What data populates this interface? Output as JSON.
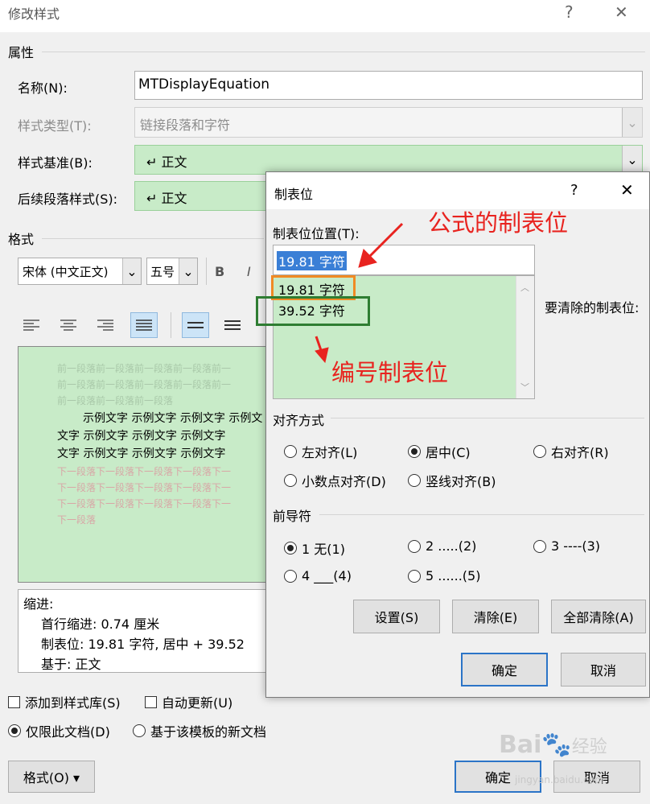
{
  "main_dialog": {
    "title": "修改样式",
    "help": "?",
    "close": "✕",
    "properties_header": "属性",
    "name_label": "名称(N):",
    "name_value": "MTDisplayEquation",
    "style_type_label": "样式类型(T):",
    "style_type_value": "链接段落和字符",
    "based_on_label": "样式基准(B):",
    "based_on_value": "↵ 正文",
    "following_label": "后续段落样式(S):",
    "following_value": "↵ 正文",
    "format_header": "格式",
    "font_value": "宋体 (中文正文)",
    "size_value": "五号",
    "bold": "B",
    "italic": "I",
    "preview": {
      "prev_para_lines": [
        "前一段落前一段落前一段落前一段落前一",
        "前一段落前一段落前一段落前一段落前一",
        "前一段落前一段落前一段落"
      ],
      "sample_lines": [
        "示例文字  示例文字  示例文字  示例文",
        "文字  示例文字  示例文字  示例文字  ",
        "文字  示例文字  示例文字  示例文字  "
      ],
      "next_para_lines": [
        "下一段落下一段落下一段落下一段落下一",
        "下一段落下一段落下一段落下一段落下一",
        "下一段落下一段落下一段落下一段落下一",
        "下一段落"
      ]
    },
    "description": {
      "line1": "缩进:",
      "line2": "首行缩进:  0.74 厘米",
      "line3": "制表位:  19.81 字符, 居中  +   39.52",
      "line4": "基于: 正文"
    },
    "add_to_gallery": "添加到样式库(S)",
    "auto_update": "自动更新(U)",
    "only_this_doc": "仅限此文档(D)",
    "new_docs_template": "基于该模板的新文档",
    "format_button": "格式(O) ▾",
    "ok": "确定",
    "cancel": "取消"
  },
  "tab_dialog": {
    "title": "制表位",
    "help": "?",
    "close": "✕",
    "position_label": "制表位位置(T):",
    "position_value": "19.81 字符",
    "list_items": [
      "19.81 字符",
      "39.52 字符"
    ],
    "clear_label": "要清除的制表位:",
    "alignment_header": "对齐方式",
    "align_left": "左对齐(L)",
    "align_center": "居中(C)",
    "align_right": "右对齐(R)",
    "align_decimal": "小数点对齐(D)",
    "align_bar": "竖线对齐(B)",
    "leader_header": "前导符",
    "leader_1": "1 无(1)",
    "leader_2": "2 .....(2)",
    "leader_3": "3 ----(3)",
    "leader_4": "4 ___(4)",
    "leader_5": "5 ......(5)",
    "set_button": "设置(S)",
    "clear_button": "清除(E)",
    "clear_all_button": "全部清除(A)",
    "ok": "确定",
    "cancel": "取消"
  },
  "annotations": {
    "formula_tab": "公式的制表位",
    "number_tab": "编号制表位"
  },
  "watermark": {
    "brand": "Bai",
    "brand2": "经验",
    "url": "jingyan.baidu.com"
  },
  "colors": {
    "green_fill": "#c8ebc8",
    "orange_box": "#f08a24",
    "green_box": "#2e7d32",
    "annotation_red": "#e8231f",
    "default_button_border": "#2b74c7"
  }
}
